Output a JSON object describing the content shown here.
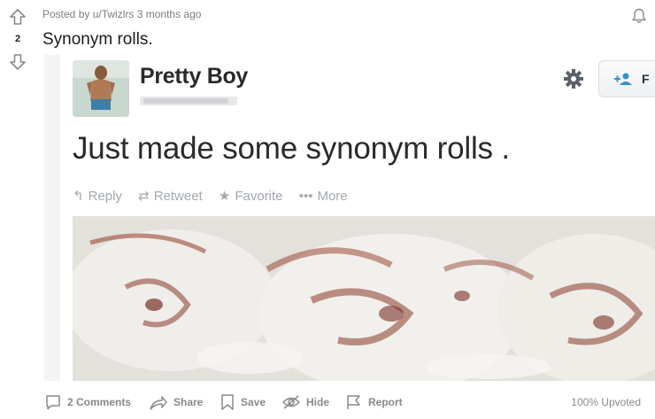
{
  "post": {
    "score": "2",
    "posted_prefix": "Posted by",
    "author": "u/Twizlrs",
    "time": "3 months ago",
    "title": "Synonym rolls."
  },
  "tweet": {
    "display_name": "Pretty Boy",
    "text": "Just made some synonym rolls .",
    "follow_label": "F",
    "actions": {
      "reply": "Reply",
      "retweet": "Retweet",
      "favorite": "Favorite",
      "more": "More"
    }
  },
  "actions": {
    "comments": "2 Comments",
    "share": "Share",
    "save": "Save",
    "hide": "Hide",
    "report": "Report",
    "upvoted": "100% Upvoted"
  },
  "colors": {
    "meta_gray": "#787c7e",
    "action_gray": "#878a8c",
    "twitter_blue": "#3a8ec8",
    "icing": "#ecebe6",
    "cinnamon": "#8a3a2a"
  },
  "icons": [
    "upvote-arrow-icon",
    "downvote-arrow-icon",
    "bell-icon",
    "gear-icon",
    "follow-person-icon",
    "comment-icon",
    "share-icon",
    "save-icon",
    "hide-icon",
    "report-icon"
  ]
}
